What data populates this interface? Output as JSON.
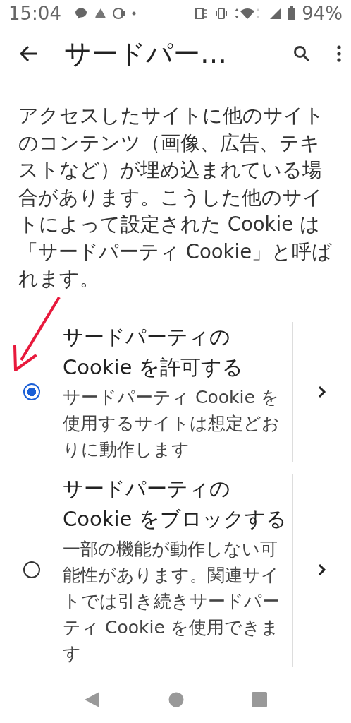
{
  "status_bar": {
    "time": "15:04",
    "battery": "94%"
  },
  "toolbar": {
    "title": "サードパー…"
  },
  "description": "アクセスしたサイトに他のサイトのコンテンツ（画像、広告、テキストなど）が埋め込まれている場合があります。こうした他のサイトによって設定された Cookie は「サードパーティ Cookie」と呼ばれます。",
  "options": [
    {
      "title": "サードパーティの Cookie を許可する",
      "description": "サードパーティ Cookie を使用するサイトは想定どおりに動作します",
      "selected": true
    },
    {
      "title": "サードパーティの Cookie をブロックする",
      "description": "一部の機能が動作しない可能性があります。関連サイトでは引き続きサードパーティ Cookie を使用できます",
      "selected": false
    }
  ]
}
